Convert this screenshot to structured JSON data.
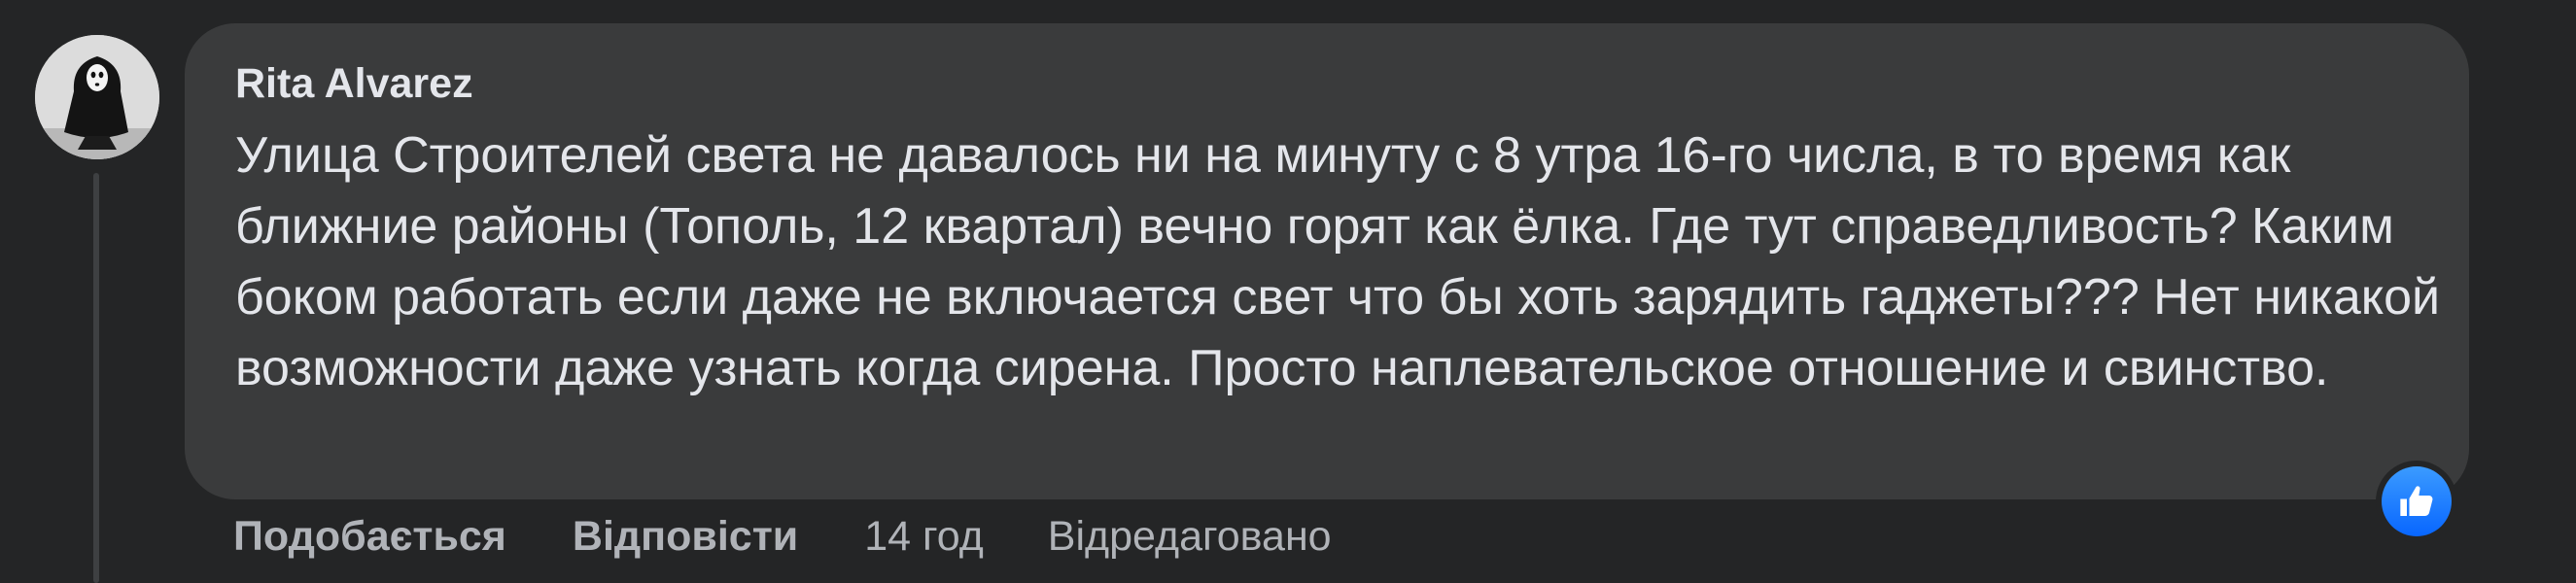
{
  "comment": {
    "author": "Rita Alvarez",
    "text": "Улица Строителей света не давалось ни на минуту с 8 утра 16-го числа, в то время как ближние районы (Тополь, 12 квартал) вечно горят как ёлка. Где тут справедливость? Каким боком работать если даже не включается свет что бы хоть зарядить гаджеты??? Нет никакой возможности даже узнать когда сирена. Просто наплевательское отношение и свинство.",
    "reaction_icon": "like-icon"
  },
  "actions": {
    "like_label": "Подобається",
    "reply_label": "Відповісти",
    "timestamp": "14 год",
    "edited_label": "Відредаговано"
  },
  "colors": {
    "background": "#242526",
    "bubble": "#3a3b3c",
    "text": "#e4e6eb",
    "secondary_text": "#b0b3b8",
    "like_blue": "#0866ff"
  }
}
